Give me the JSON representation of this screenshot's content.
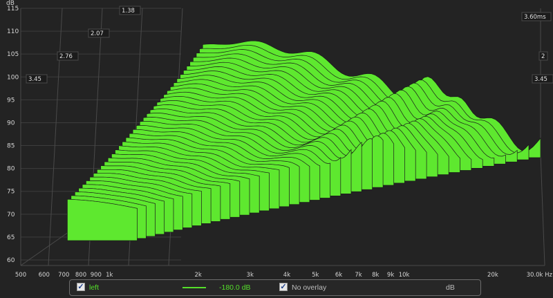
{
  "chart_data": {
    "type": "waterfall",
    "ylabel": "dB",
    "yticks": [
      115,
      110,
      105,
      100,
      95,
      90,
      85,
      80,
      75,
      70,
      65,
      60
    ],
    "ylim": [
      58,
      115
    ],
    "xticks": [
      "500",
      "600",
      "700",
      "800",
      "900",
      "1k",
      "2k",
      "3k",
      "4k",
      "5k",
      "6k",
      "7k",
      "8k",
      "9k",
      "10k",
      "20k",
      "30.0k Hz"
    ],
    "x_freqs": [
      500,
      600,
      700,
      800,
      900,
      1000,
      2000,
      3000,
      4000,
      5000,
      6000,
      7000,
      8000,
      9000,
      10000,
      20000,
      30000
    ],
    "xlim_hz": [
      500,
      30000
    ],
    "x_scale": "log",
    "time_axis_labels": [
      "3.45",
      "2.76",
      "2.07",
      "1.38",
      "3.60ms",
      "3.45",
      "2"
    ],
    "fill_color": "#5ee82f",
    "edge_color": "#1a1a1a",
    "slices": 40
  },
  "legend": {
    "channel_label": "left",
    "channel_color": "#55e02a",
    "level": "-180.0 dB",
    "overlay_label": "No overlay",
    "unit": "dB"
  }
}
